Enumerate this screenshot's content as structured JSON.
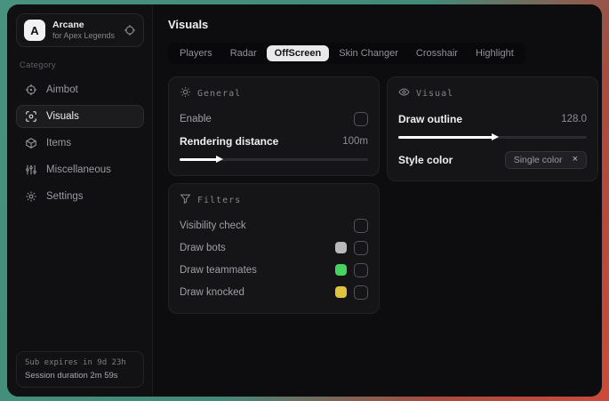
{
  "app": {
    "name": "Arcane",
    "subtitle": "for Apex Legends",
    "logo_letter": "A"
  },
  "sidebar": {
    "category_label": "Category",
    "items": [
      {
        "label": "Aimbot"
      },
      {
        "label": "Visuals"
      },
      {
        "label": "Items"
      },
      {
        "label": "Miscellaneous"
      },
      {
        "label": "Settings"
      }
    ],
    "selected_item": "Visuals",
    "session": {
      "sub_expires": "Sub expires in 9d 23h",
      "duration": "Session duration 2m 59s"
    }
  },
  "header": {
    "title": "Visuals"
  },
  "tabs": {
    "items": [
      {
        "label": "Players"
      },
      {
        "label": "Radar"
      },
      {
        "label": "OffScreen"
      },
      {
        "label": "Skin Changer"
      },
      {
        "label": "Crosshair"
      },
      {
        "label": "Highlight"
      }
    ],
    "selected": "OffScreen"
  },
  "panels": {
    "general": {
      "title": "General",
      "enable_label": "Enable",
      "enable_checked": false,
      "rendering_distance_label": "Rendering distance",
      "rendering_distance_value": "100m",
      "rendering_distance_fill": "20%"
    },
    "visual": {
      "title": "Visual",
      "draw_outline_label": "Draw outline",
      "draw_outline_value": "128.0",
      "draw_outline_fill": "50%",
      "style_color_label": "Style color",
      "style_color_value": "Single color",
      "style_color_clear": "×"
    },
    "filters": {
      "title": "Filters",
      "rows": [
        {
          "label": "Visibility check",
          "swatch": "",
          "checked": false
        },
        {
          "label": "Draw bots",
          "swatch": "#b9b9bb",
          "checked": false
        },
        {
          "label": "Draw teammates",
          "swatch": "#46d35f",
          "checked": false
        },
        {
          "label": "Draw knocked",
          "swatch": "#e0c23f",
          "checked": false
        }
      ]
    }
  },
  "colors": {
    "bg_gradient_start": "#47937f",
    "bg_gradient_end": "#cc4a39",
    "window_bg": "#0d0d0f",
    "card_bg": "#151517",
    "accent_selected_tab": "#e9e9eb",
    "swatch_bots": "#b9b9bb",
    "swatch_teammates": "#46d35f",
    "swatch_knocked": "#e0c23f"
  }
}
